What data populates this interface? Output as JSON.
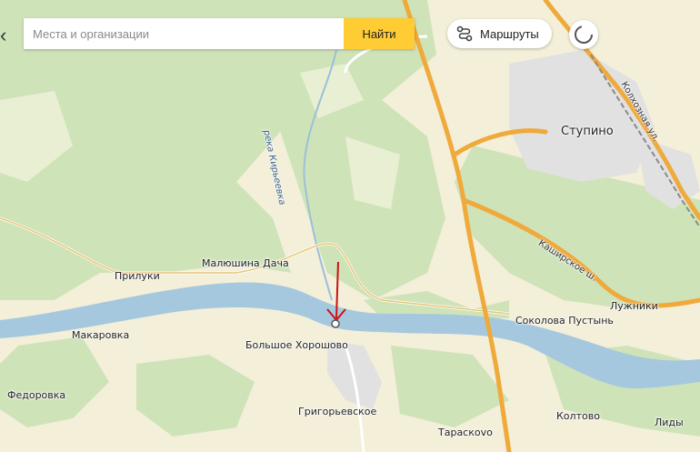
{
  "search": {
    "placeholder": "Места и организации",
    "find_label": "Найти"
  },
  "toolbar": {
    "routes_label": "Маршруты"
  },
  "colors": {
    "land": "#f3efd9",
    "forest": "#cfe3b9",
    "water": "#a6c8de",
    "highway": "#f0a93b",
    "urban": "#e2e2e2",
    "marker": "#cc1111"
  },
  "places": {
    "stupino": "Ступино",
    "prilukі": "Прилуки",
    "malyushina": "Малюшина Дача",
    "makarovka": "Макаровка",
    "bolshoe": "Большое Хорошово",
    "fedorovka": "Федоровка",
    "grigorievskoe": "Григорьевское",
    "taraskovo": "Тараскovo",
    "koltovo": "Колтово",
    "lidy": "Лиды",
    "luzhniki": "Лужники",
    "sokolova": "Соколова Пустынь"
  },
  "roads": {
    "kashirskoe": "Каширское ш.",
    "kolkhoznaya": "Колхозная ул."
  },
  "rivers": {
    "kiryaevka": "река Кирьеевка"
  }
}
